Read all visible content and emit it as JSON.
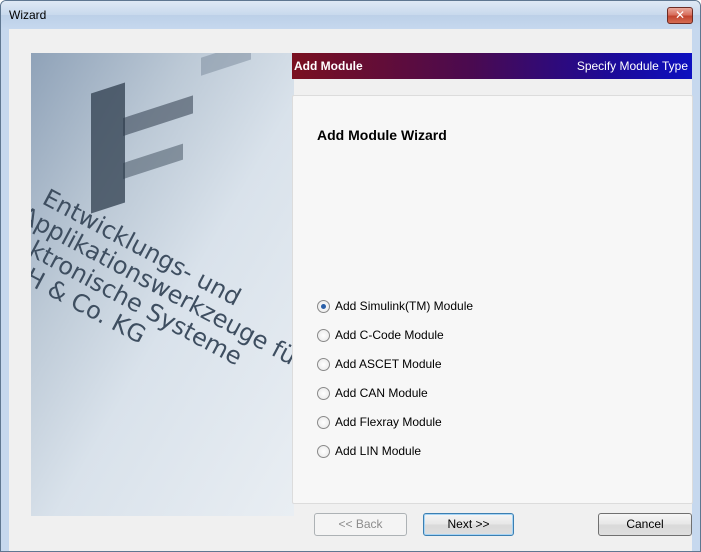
{
  "window": {
    "title": "Wizard"
  },
  "header": {
    "title": "Add Module",
    "subtitle": "Specify Module Type"
  },
  "side_image": {
    "lines": [
      "Entwicklungs- und",
      "Applikationswerkzeuge für",
      "elektronische Systeme",
      "GmbH & Co. KG"
    ]
  },
  "content": {
    "heading": "Add Module Wizard",
    "options": [
      {
        "label": "Add Simulink(TM) Module",
        "checked": true
      },
      {
        "label": "Add C-Code Module",
        "checked": false
      },
      {
        "label": "Add ASCET Module",
        "checked": false
      },
      {
        "label": "Add CAN Module",
        "checked": false
      },
      {
        "label": "Add Flexray Module",
        "checked": false
      },
      {
        "label": "Add LIN Module",
        "checked": false
      }
    ]
  },
  "buttons": {
    "back": "<< Back",
    "next": "Next >>",
    "cancel": "Cancel"
  },
  "colors": {
    "header_start": "#7a1020",
    "header_end": "#0d10c0",
    "radio_dot": "#2a5fa8"
  }
}
